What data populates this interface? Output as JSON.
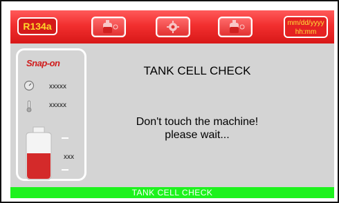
{
  "header": {
    "gas_label": "R134a",
    "date_format": "mm/dd/yyyy",
    "time_format": "hh:mm",
    "buttons": [
      {
        "icon": "tank-icon"
      },
      {
        "icon": "gear-icon"
      },
      {
        "icon": "tank-icon"
      }
    ]
  },
  "left_panel": {
    "brand": "Snap-on",
    "pressure_value": "xxxxx",
    "temperature_value": "xxxxx",
    "tank_value": "xxx"
  },
  "main": {
    "title": "TANK CELL CHECK",
    "message_line1": "Don't touch the machine!",
    "message_line2": "please wait..."
  },
  "status_bar": {
    "text": "TANK CELL CHECK"
  },
  "colors": {
    "header_red": "#e52a2a",
    "gas_text": "#ffd72a",
    "panel_gray": "#d4d4d4",
    "status_green": "#1df21d",
    "tank_fill": "#d42a2a"
  }
}
